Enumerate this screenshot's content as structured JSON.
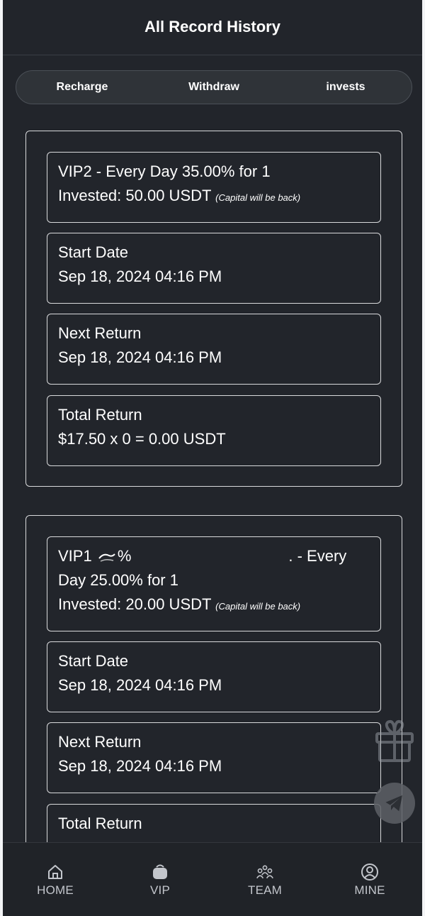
{
  "header": {
    "title": "All Record History"
  },
  "tabs": [
    {
      "label": "Recharge"
    },
    {
      "label": "Withdraw"
    },
    {
      "label": "invests"
    }
  ],
  "records": [
    {
      "plan_line": "VIP2 - Every Day 35.00% for 1",
      "invested": "Invested: 50.00 USDT",
      "capital_note": "(Capital will be back)",
      "start_label": "Start Date",
      "start_value": "Sep 18, 2024 04:16 PM",
      "next_label": "Next Return",
      "next_value": "Sep 18, 2024 04:16 PM",
      "total_label": "Total Return",
      "total_value": "$17.50 x 0 = 0.00 USDT"
    },
    {
      "plan_prefix": "VIP1 ",
      "plan_partial": "%",
      "plan_suffix": ". - Every",
      "plan_line2": "Day 25.00% for 1",
      "invested": "Invested: 20.00 USDT",
      "capital_note": "(Capital will be back)",
      "start_label": "Start Date",
      "start_value": "Sep 18, 2024 04:16 PM",
      "next_label": "Next Return",
      "next_value": "Sep 18, 2024 04:16 PM",
      "total_label": "Total Return"
    }
  ],
  "nav": [
    {
      "label": "HOME",
      "icon": "home-icon"
    },
    {
      "label": "VIP",
      "icon": "basket-icon"
    },
    {
      "label": "TEAM",
      "icon": "team-icon"
    },
    {
      "label": "MINE",
      "icon": "user-icon"
    }
  ],
  "floating": {
    "gift_icon": "gift-icon",
    "telegram_icon": "telegram-icon"
  }
}
